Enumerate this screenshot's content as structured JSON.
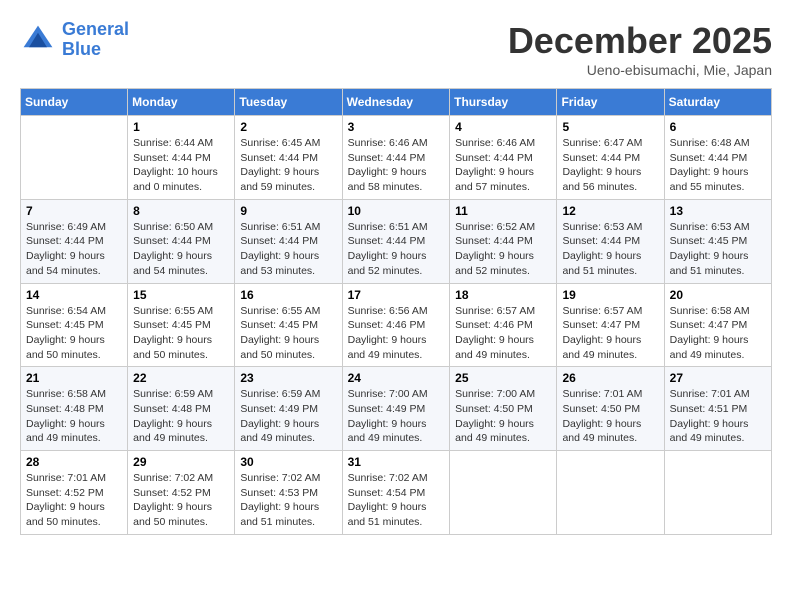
{
  "logo": {
    "line1": "General",
    "line2": "Blue"
  },
  "title": "December 2025",
  "location": "Ueno-ebisumachi, Mie, Japan",
  "days_of_week": [
    "Sunday",
    "Monday",
    "Tuesday",
    "Wednesday",
    "Thursday",
    "Friday",
    "Saturday"
  ],
  "weeks": [
    [
      {
        "day": "",
        "info": ""
      },
      {
        "day": "1",
        "info": "Sunrise: 6:44 AM\nSunset: 4:44 PM\nDaylight: 10 hours\nand 0 minutes."
      },
      {
        "day": "2",
        "info": "Sunrise: 6:45 AM\nSunset: 4:44 PM\nDaylight: 9 hours\nand 59 minutes."
      },
      {
        "day": "3",
        "info": "Sunrise: 6:46 AM\nSunset: 4:44 PM\nDaylight: 9 hours\nand 58 minutes."
      },
      {
        "day": "4",
        "info": "Sunrise: 6:46 AM\nSunset: 4:44 PM\nDaylight: 9 hours\nand 57 minutes."
      },
      {
        "day": "5",
        "info": "Sunrise: 6:47 AM\nSunset: 4:44 PM\nDaylight: 9 hours\nand 56 minutes."
      },
      {
        "day": "6",
        "info": "Sunrise: 6:48 AM\nSunset: 4:44 PM\nDaylight: 9 hours\nand 55 minutes."
      }
    ],
    [
      {
        "day": "7",
        "info": "Sunrise: 6:49 AM\nSunset: 4:44 PM\nDaylight: 9 hours\nand 54 minutes."
      },
      {
        "day": "8",
        "info": "Sunrise: 6:50 AM\nSunset: 4:44 PM\nDaylight: 9 hours\nand 54 minutes."
      },
      {
        "day": "9",
        "info": "Sunrise: 6:51 AM\nSunset: 4:44 PM\nDaylight: 9 hours\nand 53 minutes."
      },
      {
        "day": "10",
        "info": "Sunrise: 6:51 AM\nSunset: 4:44 PM\nDaylight: 9 hours\nand 52 minutes."
      },
      {
        "day": "11",
        "info": "Sunrise: 6:52 AM\nSunset: 4:44 PM\nDaylight: 9 hours\nand 52 minutes."
      },
      {
        "day": "12",
        "info": "Sunrise: 6:53 AM\nSunset: 4:44 PM\nDaylight: 9 hours\nand 51 minutes."
      },
      {
        "day": "13",
        "info": "Sunrise: 6:53 AM\nSunset: 4:45 PM\nDaylight: 9 hours\nand 51 minutes."
      }
    ],
    [
      {
        "day": "14",
        "info": "Sunrise: 6:54 AM\nSunset: 4:45 PM\nDaylight: 9 hours\nand 50 minutes."
      },
      {
        "day": "15",
        "info": "Sunrise: 6:55 AM\nSunset: 4:45 PM\nDaylight: 9 hours\nand 50 minutes."
      },
      {
        "day": "16",
        "info": "Sunrise: 6:55 AM\nSunset: 4:45 PM\nDaylight: 9 hours\nand 50 minutes."
      },
      {
        "day": "17",
        "info": "Sunrise: 6:56 AM\nSunset: 4:46 PM\nDaylight: 9 hours\nand 49 minutes."
      },
      {
        "day": "18",
        "info": "Sunrise: 6:57 AM\nSunset: 4:46 PM\nDaylight: 9 hours\nand 49 minutes."
      },
      {
        "day": "19",
        "info": "Sunrise: 6:57 AM\nSunset: 4:47 PM\nDaylight: 9 hours\nand 49 minutes."
      },
      {
        "day": "20",
        "info": "Sunrise: 6:58 AM\nSunset: 4:47 PM\nDaylight: 9 hours\nand 49 minutes."
      }
    ],
    [
      {
        "day": "21",
        "info": "Sunrise: 6:58 AM\nSunset: 4:48 PM\nDaylight: 9 hours\nand 49 minutes."
      },
      {
        "day": "22",
        "info": "Sunrise: 6:59 AM\nSunset: 4:48 PM\nDaylight: 9 hours\nand 49 minutes."
      },
      {
        "day": "23",
        "info": "Sunrise: 6:59 AM\nSunset: 4:49 PM\nDaylight: 9 hours\nand 49 minutes."
      },
      {
        "day": "24",
        "info": "Sunrise: 7:00 AM\nSunset: 4:49 PM\nDaylight: 9 hours\nand 49 minutes."
      },
      {
        "day": "25",
        "info": "Sunrise: 7:00 AM\nSunset: 4:50 PM\nDaylight: 9 hours\nand 49 minutes."
      },
      {
        "day": "26",
        "info": "Sunrise: 7:01 AM\nSunset: 4:50 PM\nDaylight: 9 hours\nand 49 minutes."
      },
      {
        "day": "27",
        "info": "Sunrise: 7:01 AM\nSunset: 4:51 PM\nDaylight: 9 hours\nand 49 minutes."
      }
    ],
    [
      {
        "day": "28",
        "info": "Sunrise: 7:01 AM\nSunset: 4:52 PM\nDaylight: 9 hours\nand 50 minutes."
      },
      {
        "day": "29",
        "info": "Sunrise: 7:02 AM\nSunset: 4:52 PM\nDaylight: 9 hours\nand 50 minutes."
      },
      {
        "day": "30",
        "info": "Sunrise: 7:02 AM\nSunset: 4:53 PM\nDaylight: 9 hours\nand 51 minutes."
      },
      {
        "day": "31",
        "info": "Sunrise: 7:02 AM\nSunset: 4:54 PM\nDaylight: 9 hours\nand 51 minutes."
      },
      {
        "day": "",
        "info": ""
      },
      {
        "day": "",
        "info": ""
      },
      {
        "day": "",
        "info": ""
      }
    ]
  ]
}
